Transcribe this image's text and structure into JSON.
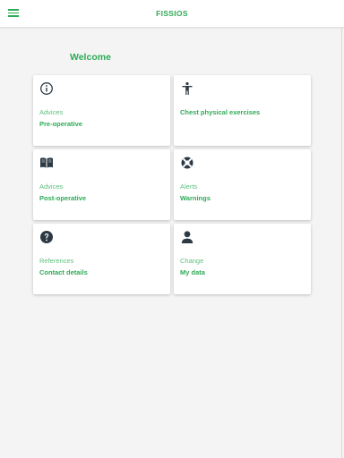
{
  "header": {
    "title": "FISSIOS",
    "menu_icon": "hamburger-menu-icon"
  },
  "welcome": "Welcome",
  "cards": [
    {
      "caption": "Advices",
      "label": "Pre-operative",
      "icon": "info-circle-icon"
    },
    {
      "caption": "",
      "label": "Chest physical exercises",
      "icon": "person-standing-icon"
    },
    {
      "caption": "Advices",
      "label": "Post-operative",
      "icon": "open-book-icon"
    },
    {
      "caption": "Alerts",
      "label": "Warnings",
      "icon": "life-ring-icon"
    },
    {
      "caption": "References",
      "label": "Contact details",
      "icon": "question-circle-icon"
    },
    {
      "caption": "Change",
      "label": "My data",
      "icon": "user-icon"
    }
  ],
  "colors": {
    "accent": "#2eaa57",
    "caption": "#5fbf7e",
    "icon": "#2d3a45",
    "background": "#f4f4f4"
  }
}
